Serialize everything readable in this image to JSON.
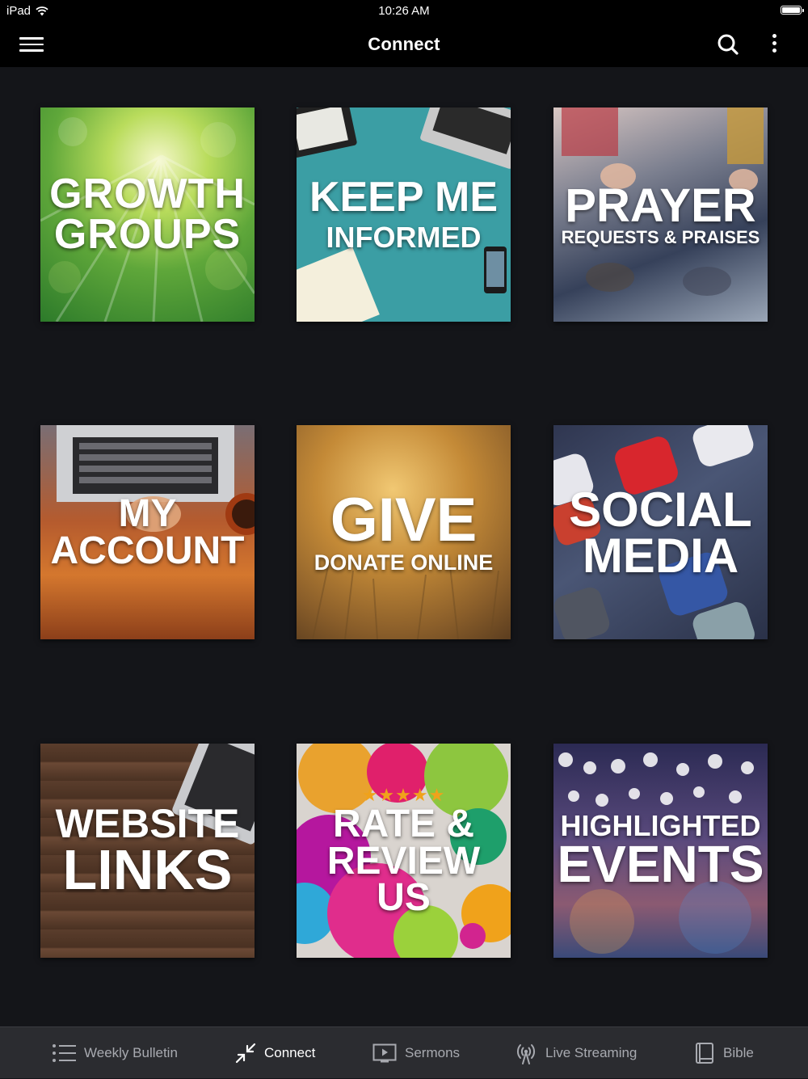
{
  "status_bar": {
    "device": "iPad",
    "time": "10:26 AM"
  },
  "nav": {
    "title": "Connect"
  },
  "tiles": [
    {
      "lines": [
        "GROWTH",
        "GROUPS"
      ]
    },
    {
      "lines": [
        "KEEP ME",
        "INFORMED"
      ]
    },
    {
      "lines": [
        "PRAYER",
        "REQUESTS & PRAISES"
      ]
    },
    {
      "lines": [
        "MY",
        "ACCOUNT"
      ]
    },
    {
      "lines": [
        "GIVE",
        "DONATE ONLINE"
      ]
    },
    {
      "lines": [
        "SOCIAL",
        "MEDIA"
      ]
    },
    {
      "lines": [
        "WEBSITE",
        "LINKS"
      ]
    },
    {
      "stars": "★★★★★",
      "lines": [
        "RATE &",
        "REVIEW",
        "US"
      ]
    },
    {
      "lines": [
        "HIGHLIGHTED",
        "EVENTS"
      ]
    }
  ],
  "tab_bar": {
    "active": "Connect",
    "items": [
      {
        "label": "Weekly Bulletin",
        "icon": "list-icon"
      },
      {
        "label": "Connect",
        "icon": "arrows-in-icon"
      },
      {
        "label": "Sermons",
        "icon": "play-screen-icon"
      },
      {
        "label": "Live Streaming",
        "icon": "broadcast-icon"
      },
      {
        "label": "Bible",
        "icon": "book-icon"
      }
    ]
  },
  "colors": {
    "background": "#141519",
    "bar": "#000000",
    "tab_bar": "#2b2c30",
    "tab_inactive": "#a8aab0",
    "tab_active": "#ffffff",
    "star": "#f0a21b"
  }
}
